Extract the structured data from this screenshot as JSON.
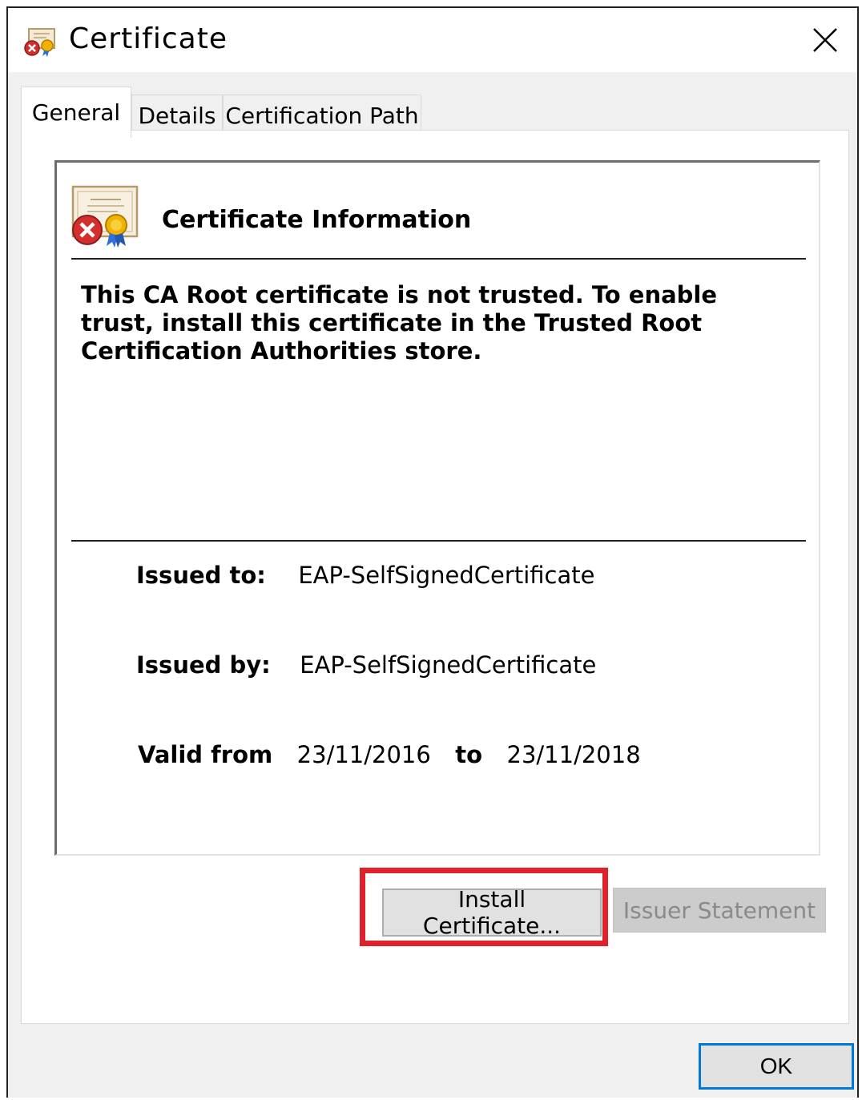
{
  "window": {
    "title": "Certificate"
  },
  "tabs": [
    {
      "label": "General",
      "active": true
    },
    {
      "label": "Details",
      "active": false
    },
    {
      "label": "Certification Path",
      "active": false
    }
  ],
  "info": {
    "heading": "Certificate Information",
    "message": "This CA Root certificate is not trusted. To enable trust, install this certificate in the Trusted Root Certification Authorities store.",
    "issued_to_label": "Issued to:",
    "issued_to_value": "EAP-SelfSignedCertificate",
    "issued_by_label": "Issued by:",
    "issued_by_value": "EAP-SelfSignedCertificate",
    "valid_from_label": "Valid from",
    "valid_from_value": "23/11/2016",
    "valid_to_label": "to",
    "valid_to_value": "23/11/2018"
  },
  "buttons": {
    "install": "Install Certificate...",
    "issuer_statement": "Issuer Statement",
    "ok": "OK"
  },
  "icons": {
    "title": "certificate-error-icon",
    "info": "certificate-error-large-icon",
    "close": "close-icon"
  },
  "colors": {
    "highlight": "#e0202a",
    "focus_border": "#0078d7",
    "error_red": "#d32f2f"
  }
}
